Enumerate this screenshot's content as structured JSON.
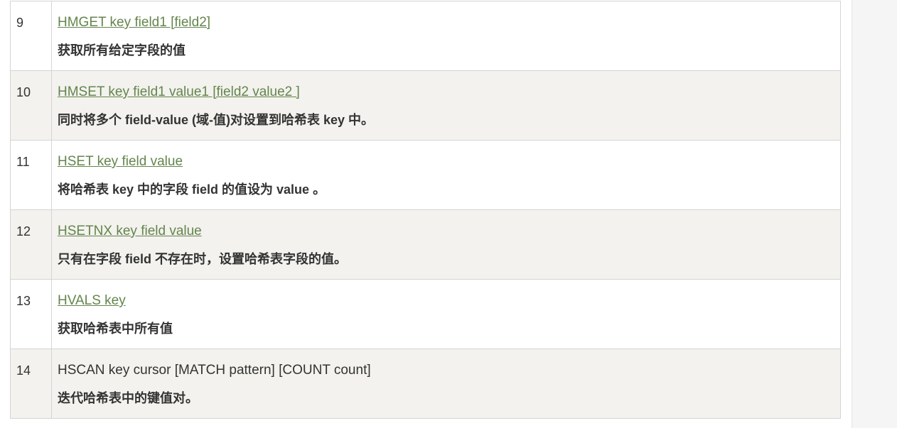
{
  "rows": [
    {
      "num": "9",
      "command": "HMGET key field1 [field2]",
      "linked": true,
      "desc": "获取所有给定字段的值"
    },
    {
      "num": "10",
      "command": "HMSET key field1 value1 [field2 value2 ]",
      "linked": true,
      "desc": "同时将多个 field-value (域-值)对设置到哈希表 key 中。"
    },
    {
      "num": "11",
      "command": "HSET key field value",
      "linked": true,
      "desc": "将哈希表 key 中的字段 field 的值设为 value 。"
    },
    {
      "num": "12",
      "command": "HSETNX key field value",
      "linked": true,
      "desc": "只有在字段 field 不存在时，设置哈希表字段的值。"
    },
    {
      "num": "13",
      "command": "HVALS key",
      "linked": true,
      "desc": "获取哈希表中所有值"
    },
    {
      "num": "14",
      "command": "HSCAN key cursor [MATCH pattern] [COUNT count]",
      "linked": false,
      "desc": "迭代哈希表中的键值对。"
    }
  ],
  "colors": {
    "link": "#64854c",
    "alt_row_bg": "#f3f2ee",
    "border": "#d4d4d4",
    "text": "#333333"
  }
}
